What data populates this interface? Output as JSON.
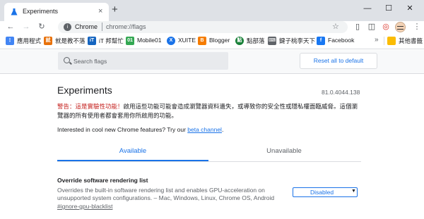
{
  "tab": {
    "title": "Experiments",
    "close": "×",
    "new": "+"
  },
  "window": {
    "minimize": "—",
    "maximize": "☐",
    "close": "✕"
  },
  "toolbar": {
    "back": "←",
    "forward": "→",
    "reload": "↻",
    "omnibox_label": "Chrome",
    "url": "chrome://flags",
    "star": "☆"
  },
  "bookmarks": {
    "items": [
      {
        "label": "應用程式",
        "icon": "apps-icon",
        "color": "#4285f4"
      },
      {
        "label": "就是教不落",
        "icon": "bookmark-site-icon",
        "color": "#e8710a"
      },
      {
        "label": "iT 邦幫忙",
        "icon": "ithome-icon",
        "color": "#1565c0"
      },
      {
        "label": "Mobile01",
        "icon": "mobile01-icon",
        "color": "#34a853"
      },
      {
        "label": "XUITE",
        "icon": "xuite-icon",
        "color": "#1a73e8"
      },
      {
        "label": "Blogger",
        "icon": "blogger-icon",
        "color": "#f57c00"
      },
      {
        "label": "點部落",
        "icon": "dotblogs-icon",
        "color": "#188038"
      },
      {
        "label": "鍵子桃李天下",
        "icon": "keyboard-icon",
        "color": "#5f6368"
      },
      {
        "label": "Facebook",
        "icon": "facebook-icon",
        "color": "#1877f2"
      }
    ],
    "more": "»",
    "other": "其他書籤"
  },
  "search": {
    "placeholder": "Search flags"
  },
  "reset_label": "Reset all to default",
  "page": {
    "title": "Experiments",
    "version": "81.0.4044.138",
    "warning_prefix": "警告：這是實驗性功能！",
    "warning_text": "啟用這些功能可能會造成瀏覽器資料遺失，或導致你的安全性或隱私權面臨威脅。這個瀏覽器的所有使用者都會套用你所啟用的功能。",
    "interest_text": "Interested in cool new Chrome features? Try our ",
    "interest_link": "beta channel",
    "interest_end": "."
  },
  "tabs": {
    "available": "Available",
    "unavailable": "Unavailable"
  },
  "flag": {
    "name": "Override software rendering list",
    "description": "Overrides the built-in software rendering list and enables GPU-acceleration on unsupported system configurations. – Mac, Windows, Linux, Chrome OS, Android",
    "hash": "#ignore-gpu-blacklist",
    "selected": "Disabled"
  },
  "colors": {
    "accent": "#1a73e8",
    "warning": "#c5221f"
  }
}
